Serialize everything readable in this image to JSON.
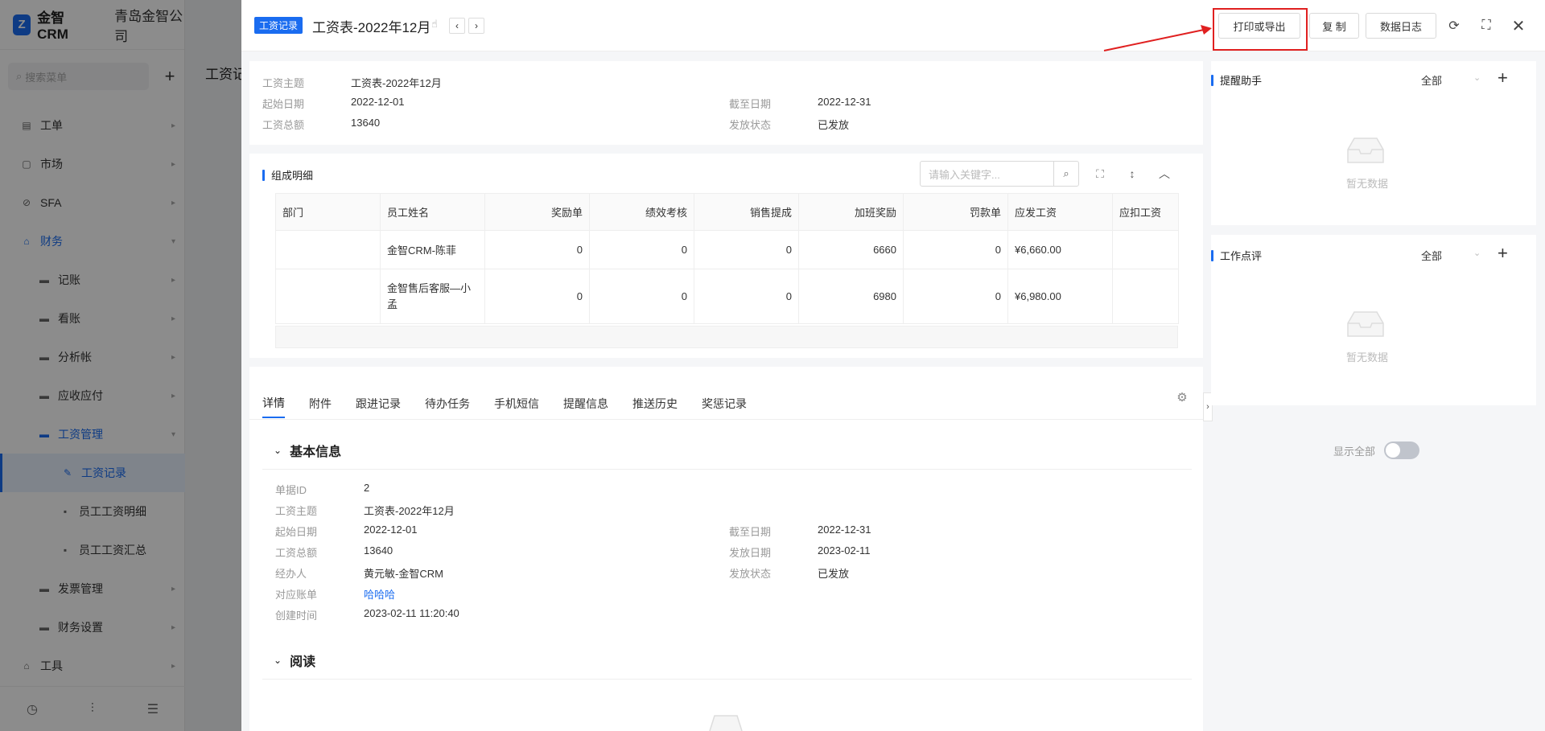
{
  "app": {
    "logo_letter": "Z",
    "logo_name": "金智CRM",
    "company": "青岛金智公司",
    "search_placeholder": "搜索菜单",
    "menu": [
      {
        "label": "工单"
      },
      {
        "label": "市场"
      },
      {
        "label": "SFA"
      },
      {
        "label": "财务"
      },
      {
        "label": "记账"
      },
      {
        "label": "看账"
      },
      {
        "label": "分析帐"
      },
      {
        "label": "应收应付"
      },
      {
        "label": "工资管理"
      },
      {
        "label": "工资记录"
      },
      {
        "label": "员工工资明细"
      },
      {
        "label": "员工工资汇总"
      },
      {
        "label": "发票管理"
      },
      {
        "label": "财务设置"
      },
      {
        "label": "工具"
      }
    ],
    "bg_page_title": "工资记"
  },
  "drawer": {
    "tag": "工资记录",
    "title": "工资表-2022年12月",
    "toolbar": {
      "print_export": "打印或导出",
      "copy": "复 制",
      "data_log": "数据日志"
    },
    "summary": {
      "subject_label": "工资主题",
      "subject": "工资表-2022年12月",
      "start_label": "起始日期",
      "start": "2022-12-01",
      "end_label": "截至日期",
      "end": "2022-12-31",
      "total_label": "工资总额",
      "total": "13640",
      "status_label": "发放状态",
      "status": "已发放"
    },
    "detail_section": {
      "title": "组成明细",
      "search_placeholder": "请输入关键字...",
      "columns": [
        "部门",
        "员工姓名",
        "奖励单",
        "绩效考核",
        "销售提成",
        "加班奖励",
        "罚款单",
        "应发工资",
        "应扣工资"
      ],
      "rows": [
        [
          "",
          "金智CRM-陈菲",
          "0",
          "0",
          "0",
          "6660",
          "0",
          "¥6,660.00",
          ""
        ],
        [
          "",
          "金智售后客服—小孟",
          "0",
          "0",
          "0",
          "6980",
          "0",
          "¥6,980.00",
          ""
        ]
      ]
    },
    "tabs": [
      "详情",
      "附件",
      "跟进记录",
      "待办任务",
      "手机短信",
      "提醒信息",
      "推送历史",
      "奖惩记录"
    ],
    "basic_info": {
      "title": "基本信息",
      "show_all": "显示全部",
      "id_label": "单据ID",
      "id": "2",
      "subject_label": "工资主题",
      "subject": "工资表-2022年12月",
      "start_label": "起始日期",
      "start": "2022-12-01",
      "end_label": "截至日期",
      "end": "2022-12-31",
      "total_label": "工资总额",
      "total": "13640",
      "pay_date_label": "发放日期",
      "pay_date": "2023-02-11",
      "handler_label": "经办人",
      "handler": "黄元敏-金智CRM",
      "status_label": "发放状态",
      "status": "已发放",
      "account_label": "对应账单",
      "account": "哈哈哈",
      "created_label": "创建时间",
      "created": "2023-02-11 11:20:40"
    },
    "read_section": {
      "title": "阅读"
    },
    "right_panels": [
      {
        "title": "提醒助手",
        "filter": "全部",
        "empty": "暂无数据"
      },
      {
        "title": "工作点评",
        "filter": "全部",
        "empty": "暂无数据"
      }
    ]
  },
  "colors": {
    "accent": "#1a6cf0",
    "highlight": "#e02020"
  }
}
